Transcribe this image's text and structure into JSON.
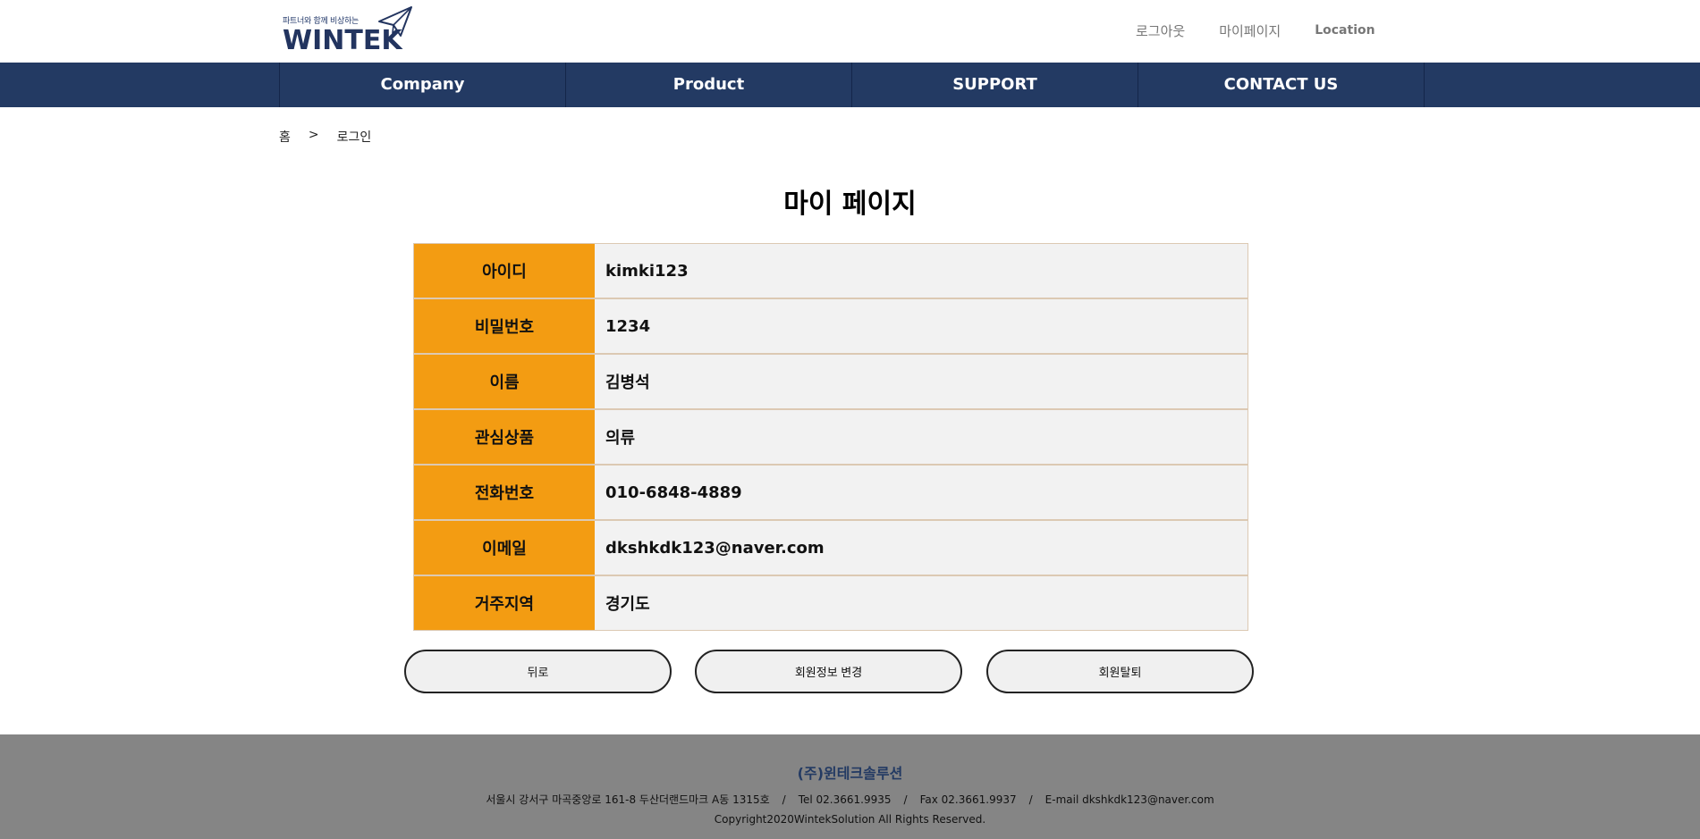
{
  "brand": {
    "tagline": "파트너와 함께 비상하는",
    "name": "WINTEK"
  },
  "top_links": {
    "logout": "로그아웃",
    "mypage": "마이페이지",
    "location": "Location"
  },
  "nav": {
    "items": [
      {
        "label": "Company"
      },
      {
        "label": "Product"
      },
      {
        "label": "SUPPORT"
      },
      {
        "label": "CONTACT US"
      }
    ]
  },
  "breadcrumb": {
    "home": "홈",
    "separator": ">",
    "current": "로그인"
  },
  "page_title": "마이 페이지",
  "profile": {
    "rows": [
      {
        "label": "아이디",
        "value": "kimki123"
      },
      {
        "label": "비밀번호",
        "value": "1234"
      },
      {
        "label": "이름",
        "value": "김병석"
      },
      {
        "label": "관심상품",
        "value": "의류"
      },
      {
        "label": "전화번호",
        "value": "010-6848-4889"
      },
      {
        "label": "이메일",
        "value": "dkshkdk123@naver.com"
      },
      {
        "label": "거주지역",
        "value": "경기도"
      }
    ]
  },
  "actions": {
    "back": "뒤로",
    "edit": "회원정보 변경",
    "withdraw": "회원탈퇴"
  },
  "footer": {
    "company": "(주)윈테크솔루션",
    "address": "서울시 강서구 마곡중앙로 161-8 두산더랜드마크 A동 1315호",
    "tel": "Tel 02.3661.9935",
    "fax": "Fax 02.3661.9937",
    "email": "E-mail dkshkdk123@naver.com",
    "separator": "/",
    "copyright": "Copyright2020WintekSolution All Rights Reserved."
  },
  "colors": {
    "nav_bg": "#233a63",
    "label_bg": "#f39c12",
    "value_bg": "#f2f2f2",
    "footer_bg": "#858585"
  },
  "icons": {
    "logo_mark": "paper-plane-icon"
  }
}
